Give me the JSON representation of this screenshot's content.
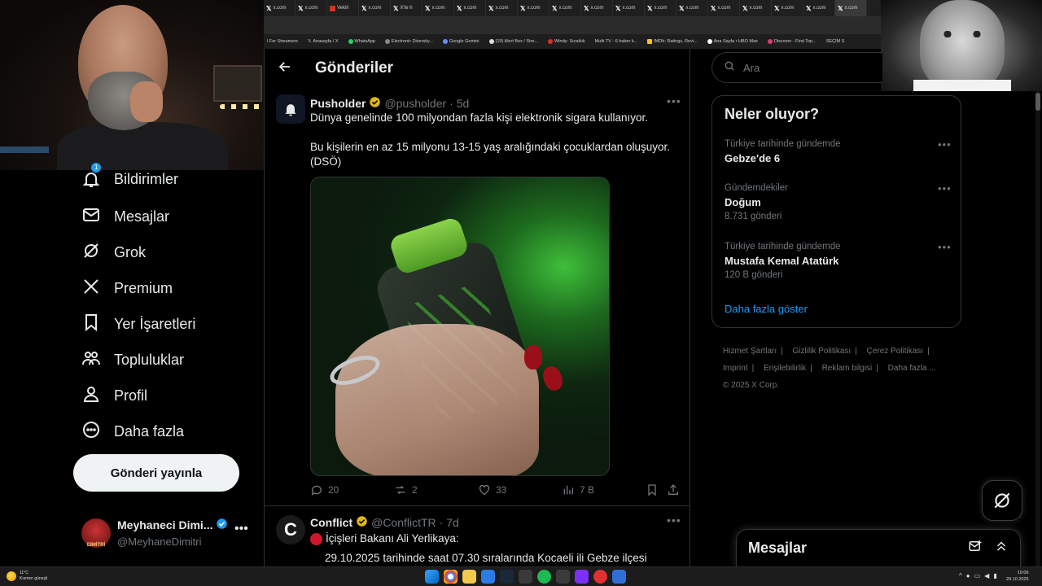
{
  "browser": {
    "tabs": [
      {
        "label": "x.com"
      },
      {
        "label": "x.com"
      },
      {
        "label": "Vekill"
      },
      {
        "label": "x.com"
      },
      {
        "label": "X'te h"
      },
      {
        "label": "x.com"
      },
      {
        "label": "x.com"
      },
      {
        "label": "x.com"
      },
      {
        "label": "x.com"
      },
      {
        "label": "x.com"
      },
      {
        "label": "x.com"
      },
      {
        "label": "x.com"
      },
      {
        "label": "x.com"
      },
      {
        "label": "x.com"
      },
      {
        "label": "x.com"
      },
      {
        "label": "x.com"
      },
      {
        "label": "x.com"
      },
      {
        "label": "x.com"
      },
      {
        "label": "x.com"
      }
    ],
    "bookmarks": [
      {
        "label": "l For Streamers"
      },
      {
        "label": "Anasayfa / X"
      },
      {
        "label": "WhatsApp"
      },
      {
        "label": "Electronic Diversity..."
      },
      {
        "label": "Google Gemini"
      },
      {
        "label": "(19) Alert Box / Stre..."
      },
      {
        "label": "Windy: Sıcaklık"
      },
      {
        "label": "Multi TV - 6 haber k..."
      },
      {
        "label": "IMDb: Ratings, Revi..."
      },
      {
        "label": "Ana Sayfa • HBO Max"
      },
      {
        "label": "Discover - Find Top..."
      },
      {
        "label": "SEÇİM S"
      }
    ]
  },
  "nav": {
    "notifications": "Bildirimler",
    "notifications_badge": "1",
    "messages": "Mesajlar",
    "grok": "Grok",
    "premium": "Premium",
    "bookmarks": "Yer İşaretleri",
    "communities": "Topluluklar",
    "profile": "Profil",
    "more": "Daha fazla",
    "post_button": "Gönderi yayınla"
  },
  "account": {
    "display_name": "Meyhaneci Dimi...",
    "handle": "@MeyhaneDimitri",
    "avatar_text": "DİMİTRİ"
  },
  "header": {
    "title": "Gönderiler"
  },
  "tweets": [
    {
      "name": "Pusholder",
      "handle": "@pusholder",
      "time": "· 5d",
      "text1": "Dünya genelinde 100 milyondan fazla kişi elektronik sigara kullanıyor.",
      "text2": "Bu kişilerin en az 15 milyonu 13-15 yaş aralığındaki çocuklardan oluşuyor. (DSÖ)",
      "replies": "20",
      "reposts": "2",
      "likes": "33",
      "views": "7 B"
    },
    {
      "name": "Conflict",
      "handle": "@ConflictTR",
      "time": "· 7d",
      "text1": "İçişleri Bakanı Ali Yerlikaya:",
      "text2": "29.10.2025 tarihinde saat 07.30 sıralarında Kocaeli ili Gebze ilçesi"
    }
  ],
  "search": {
    "placeholder": "Ara"
  },
  "trends": {
    "title": "Neler oluyor?",
    "items": [
      {
        "context": "Türkiye tarihinde gündemde",
        "title": "Gebze'de 6",
        "count": ""
      },
      {
        "context": "Gündemdekiler",
        "title": "Doğum",
        "count": "8.731 gönderi"
      },
      {
        "context": "Türkiye tarihinde gündemde",
        "title": "Mustafa Kemal Atatürk",
        "count": "120 B gönderi"
      }
    ],
    "show_more": "Daha fazla göster"
  },
  "footer": {
    "links": [
      "Hizmet Şartları",
      "Gizlilik Politikası",
      "Çerez Politikası",
      "Imprint",
      "Erişilebilirlik",
      "Reklam bilgisi",
      "Daha fazla ..."
    ],
    "copyright": "© 2025 X Corp."
  },
  "messages_drawer": {
    "title": "Mesajlar"
  },
  "taskbar": {
    "temp": "11°C",
    "weather": "Kısmen güneşli",
    "time": "10:06",
    "date": "29.10.2025"
  },
  "colors": {
    "accent": "#1d9bf0",
    "background": "#000000",
    "muted": "#71767b",
    "gold_check": "#e2b719"
  }
}
